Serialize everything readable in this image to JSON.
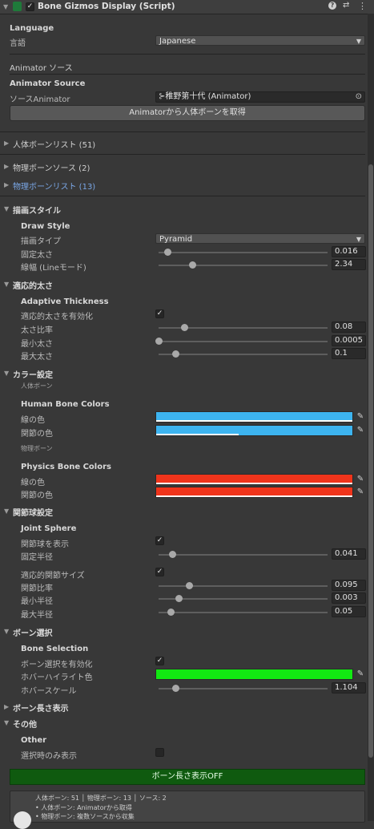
{
  "header": {
    "title": "Bone Gizmos Display (Script)",
    "enabled_check": "✓"
  },
  "language": {
    "heading": "Language",
    "label": "言語",
    "value": "Japanese"
  },
  "animator": {
    "section": "Animator ソース",
    "heading": "Animator Source",
    "label": "ソースAnimator",
    "value": "稚野第十代 (Animator)",
    "button": "Animatorから人体ボーンを取得"
  },
  "foldouts": {
    "human_list": "人体ボーンリスト (51)",
    "physics_source": "物理ボーンソース (2)",
    "physics_list": "物理ボーンリスト (13)"
  },
  "draw": {
    "section": "描画スタイル",
    "heading": "Draw Style",
    "type_label": "描画タイプ",
    "type_value": "Pyramid",
    "thickness_label": "固定太さ",
    "thickness_value": "0.016",
    "thickness_level": 0.05,
    "line_label": "線幅 (Lineモード)",
    "line_value": "2.34",
    "line_level": 0.2
  },
  "adaptive": {
    "section": "適応的太さ",
    "heading": "Adaptive Thickness",
    "enable_label": "適応的太さを有効化",
    "ratio_label": "太さ比率",
    "ratio_value": "0.08",
    "ratio_level": 0.15,
    "min_label": "最小太さ",
    "min_value": "0.0005",
    "min_level": 0.0,
    "max_label": "最大太さ",
    "max_value": "0.1",
    "max_level": 0.1
  },
  "colors": {
    "section": "カラー設定",
    "human_note": "人体ボーン",
    "human_heading": "Human Bone Colors",
    "human_line_label": "線の色",
    "human_joint_label": "関節の色",
    "human_color": "#3db4f0",
    "human_line_alpha": 1.0,
    "human_joint_alpha": 0.42,
    "physics_note": "物理ボーン",
    "physics_heading": "Physics Bone Colors",
    "physics_line_label": "線の色",
    "physics_joint_label": "関節の色",
    "physics_color": "#f0341b",
    "physics_line_alpha": 1.0,
    "physics_joint_alpha": 1.0
  },
  "joint": {
    "section": "関節球設定",
    "heading": "Joint Sphere",
    "show_label": "関節球を表示",
    "radius_label": "固定半径",
    "radius_value": "0.041",
    "radius_level": 0.08,
    "adaptive_label": "適応的関節サイズ",
    "ratio_label": "関節比率",
    "ratio_value": "0.095",
    "ratio_level": 0.18,
    "min_label": "最小半径",
    "min_value": "0.003",
    "min_level": 0.12,
    "max_label": "最大半径",
    "max_value": "0.05",
    "max_level": 0.07
  },
  "selection": {
    "section": "ボーン選択",
    "heading": "Bone Selection",
    "enable_label": "ボーン選択を有効化",
    "hover_color_label": "ホバーハイライト色",
    "hover_color": "#12e812",
    "hover_scale_label": "ホバースケール",
    "hover_scale_value": "1.104",
    "hover_scale_level": 0.1
  },
  "length_section": "ボーン長さ表示",
  "other": {
    "section": "その他",
    "heading": "Other",
    "only_selected_label": "選択時のみ表示"
  },
  "green_button": "ボーン長さ表示OFF",
  "help": {
    "summary": "人体ボーン: 51 │ 物理ボーン: 13 │ ソース: 2",
    "line1": "• 人体ボーン: Animatorから取得",
    "line2": "• 物理ボーン: 複数ソースから収集"
  }
}
